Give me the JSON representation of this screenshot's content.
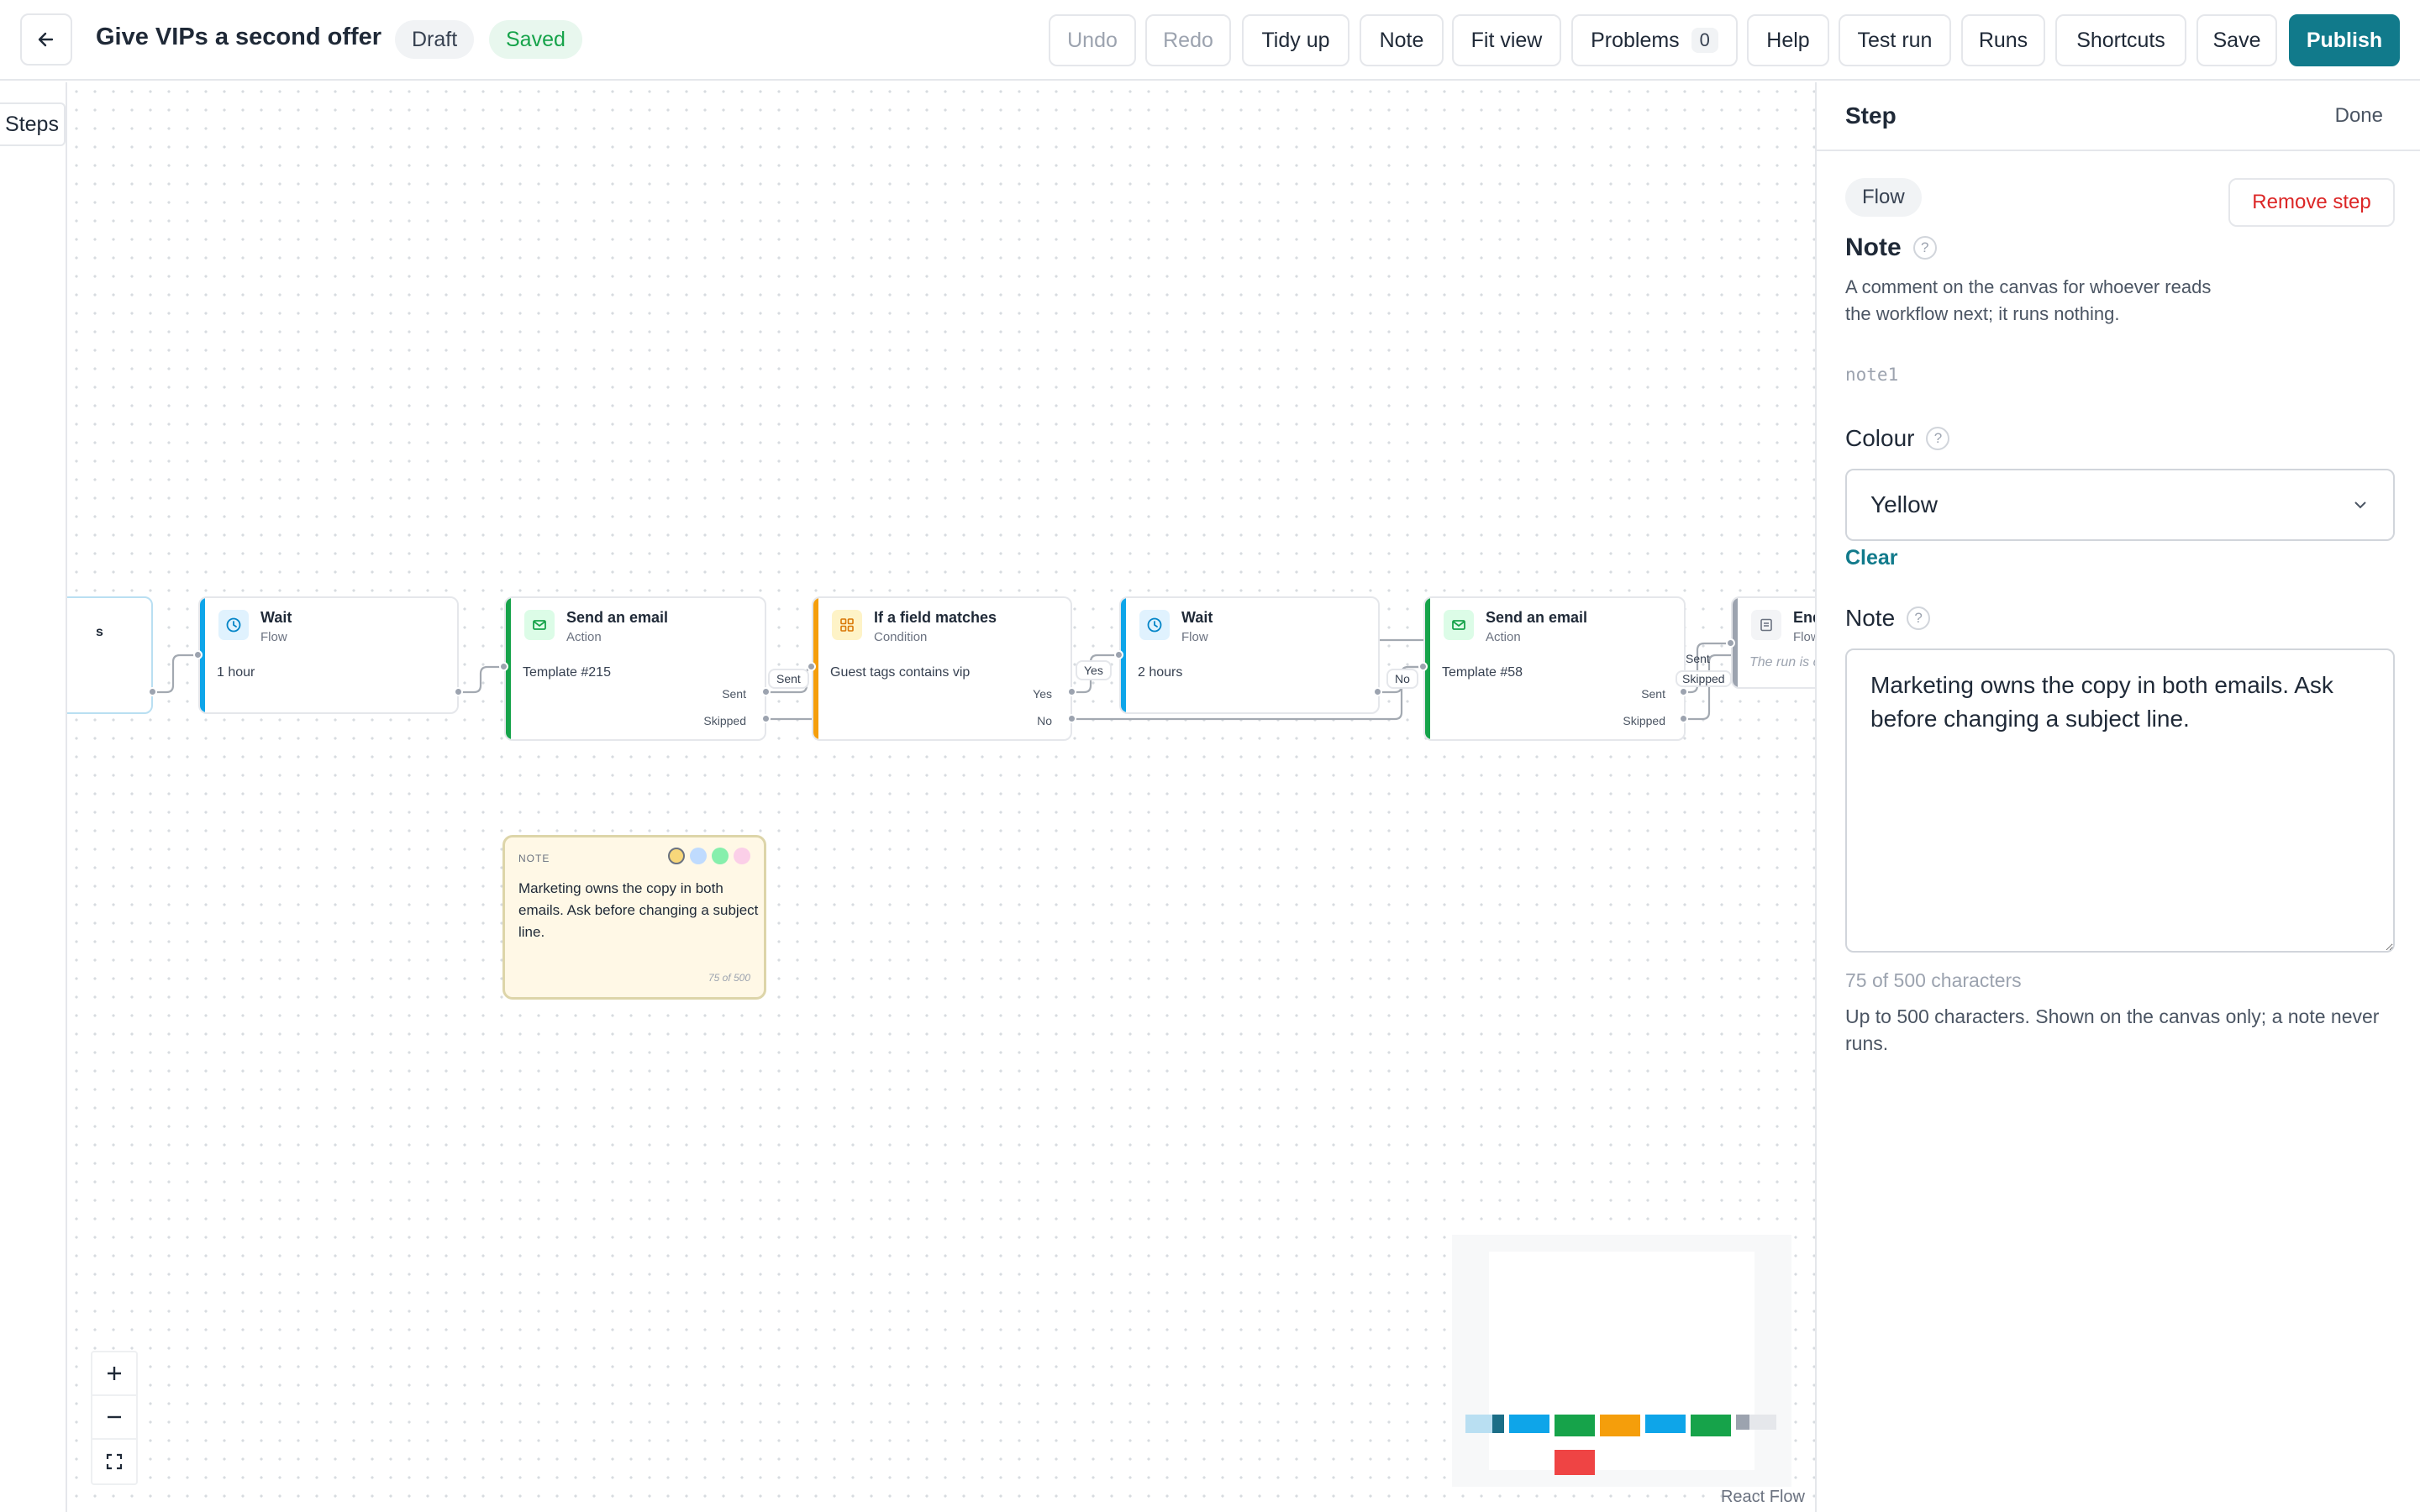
{
  "header": {
    "back_icon": "arrow-left-icon",
    "title": "Give VIPs a second offer",
    "status_draft": "Draft",
    "status_saved": "Saved",
    "buttons": {
      "undo": "Undo",
      "redo": "Redo",
      "tidy": "Tidy up",
      "note": "Note",
      "fit": "Fit view",
      "problems": "Problems",
      "problems_count": "0",
      "help": "Help",
      "test_run": "Test run",
      "runs": "Runs",
      "shortcuts": "Shortcuts",
      "save": "Save",
      "publish": "Publish"
    }
  },
  "sidebar": {
    "steps_label": "Steps"
  },
  "canvas": {
    "nodes": [
      {
        "title": "",
        "subtitle": "",
        "body": "",
        "partial_text": "s"
      },
      {
        "title": "Wait",
        "subtitle": "Flow",
        "body": "1 hour",
        "icon": "clock-icon"
      },
      {
        "title": "Send an email",
        "subtitle": "Action",
        "body": "Template #215",
        "icon": "mail-icon",
        "outputs": [
          "Sent",
          "Skipped"
        ]
      },
      {
        "title": "If a field matches",
        "subtitle": "Condition",
        "body": "Guest tags contains vip",
        "icon": "grid-icon",
        "outputs": [
          "Yes",
          "No"
        ]
      },
      {
        "title": "Wait",
        "subtitle": "Flow",
        "body": "2 hours",
        "icon": "clock-icon"
      },
      {
        "title": "Send an email",
        "subtitle": "Action",
        "body": "Template #58",
        "icon": "mail-icon",
        "outputs": [
          "Sent",
          "Skipped"
        ]
      },
      {
        "title": "End",
        "subtitle": "Flow",
        "body": "The run is c",
        "icon": "list-icon"
      }
    ],
    "edge_labels": {
      "sent": "Sent",
      "yes": "Yes",
      "no": "No",
      "sent2": "Sent",
      "skipped2": "Skipped"
    },
    "note_card": {
      "label": "NOTE",
      "text": "Marketing owns the copy in both emails. Ask before changing a subject line.",
      "count": "75 of 500",
      "swatch_colors": [
        "#f8d77a",
        "#bfdbfe",
        "#86efac",
        "#fbcfe8"
      ]
    },
    "attribution": "React Flow"
  },
  "panel": {
    "title": "Step",
    "done": "Done",
    "chip": "Flow",
    "remove": "Remove step",
    "section_title": "Note",
    "description": "A comment on the canvas for whoever reads the workflow next; it runs nothing.",
    "node_id": "note1",
    "colour_label": "Colour",
    "colour_value": "Yellow",
    "clear": "Clear",
    "note_label": "Note",
    "note_value": "Marketing owns the copy in both emails. Ask before changing a subject line.",
    "char_count": "75 of 500 characters",
    "hint": "Up to 500 characters. Shown on the canvas only; a note never runs.",
    "help_glyph": "?"
  },
  "colors": {
    "accent": "#117a8b",
    "wait": "#0ea5e9",
    "action": "#16a34a",
    "condition": "#f59e0b",
    "end": "#9ca3af",
    "danger": "#dc2626"
  }
}
